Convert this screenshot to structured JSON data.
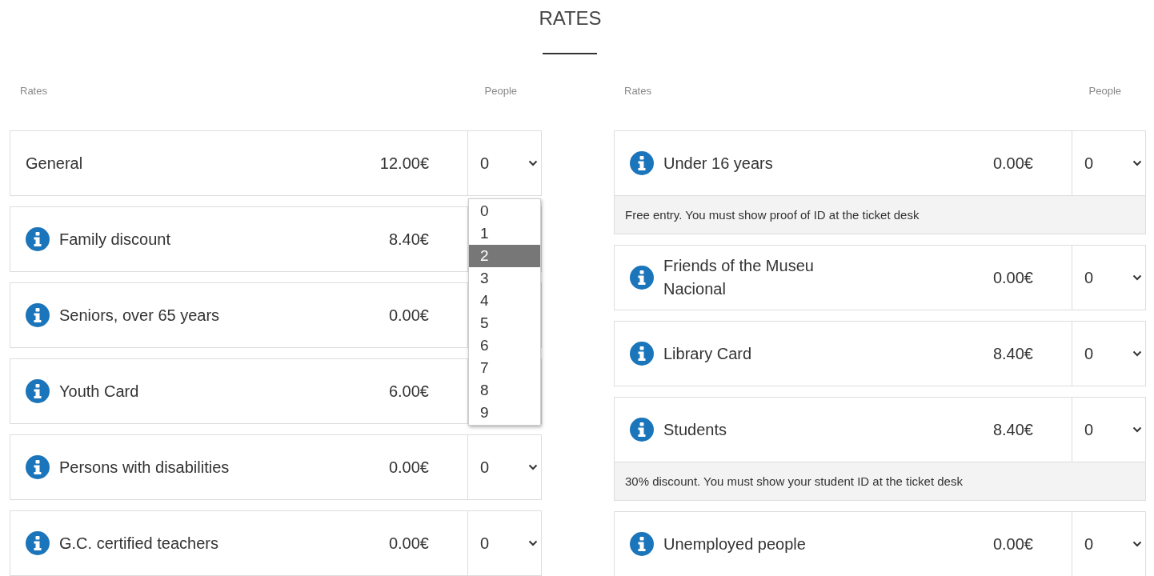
{
  "title": "RATES",
  "columns": [
    {
      "header_rates": "Rates",
      "header_people": "People",
      "rows": [
        {
          "name": "General",
          "info": false,
          "price": "12.00€",
          "quantity": "0",
          "dropdown": {
            "options": [
              {
                "label": "0",
                "selected": false
              },
              {
                "label": "1",
                "selected": false
              },
              {
                "label": "2",
                "selected": true
              },
              {
                "label": "3",
                "selected": false
              },
              {
                "label": "4",
                "selected": false
              },
              {
                "label": "5",
                "selected": false
              },
              {
                "label": "6",
                "selected": false
              },
              {
                "label": "7",
                "selected": false
              },
              {
                "label": "8",
                "selected": false
              },
              {
                "label": "9",
                "selected": false
              }
            ]
          }
        },
        {
          "name": "Family discount",
          "info": true,
          "price": "8.40€"
        },
        {
          "name": "Seniors, over 65 years",
          "info": true,
          "price": "0.00€"
        },
        {
          "name": "Youth Card",
          "info": true,
          "price": "6.00€"
        },
        {
          "name": "Persons with disabilities",
          "info": true,
          "price": "0.00€",
          "quantity": "0"
        },
        {
          "name": "G.C. certified teachers",
          "info": true,
          "price": "0.00€",
          "quantity": "0"
        }
      ]
    },
    {
      "header_rates": "Rates",
      "header_people": "People",
      "rows": [
        {
          "name": "Under 16 years",
          "info": true,
          "price": "0.00€",
          "quantity": "0",
          "note": "Free entry. You must show proof of ID at the ticket desk"
        },
        {
          "name": "Friends of the Museu Nacional",
          "info": true,
          "price": "0.00€",
          "quantity": "0"
        },
        {
          "name": "Library Card",
          "info": true,
          "price": "8.40€",
          "quantity": "0"
        },
        {
          "name": "Students",
          "info": true,
          "price": "8.40€",
          "quantity": "0",
          "note": "30% discount. You must show your student ID at the ticket desk"
        },
        {
          "name": "Unemployed people",
          "info": true,
          "price": "0.00€",
          "quantity": "0"
        }
      ]
    }
  ]
}
